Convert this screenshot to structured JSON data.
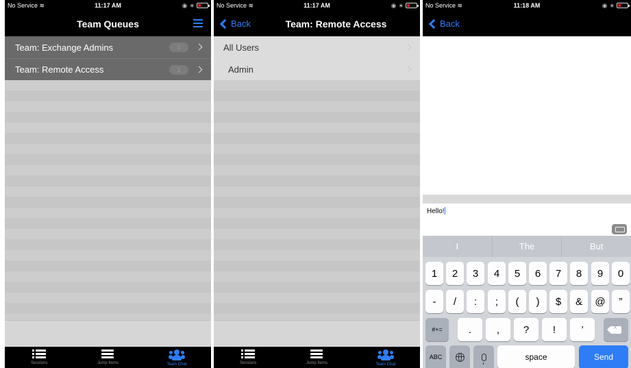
{
  "status_bars": [
    {
      "carrier": "No Service",
      "time": "11:17 AM"
    },
    {
      "carrier": "No Service",
      "time": "11:17 AM"
    },
    {
      "carrier": "No Service",
      "time": "11:18 AM"
    }
  ],
  "colors": {
    "accent": "#2f7df6",
    "nav_bg": "#000000",
    "queue_bg": "#6a6a6a",
    "battery": "#e02020"
  },
  "screen1": {
    "title": "Team Queues",
    "queues": [
      {
        "label": "Team: Exchange Admins",
        "count": "0"
      },
      {
        "label": "Team: Remote Access",
        "count": "1"
      }
    ]
  },
  "screen2": {
    "back_label": "Back",
    "title": "Team: Remote Access",
    "users": [
      {
        "label": "All Users"
      },
      {
        "label": "Admin"
      }
    ]
  },
  "screen3": {
    "back_label": "Back",
    "message_text": "Hello!",
    "predictions": [
      "I",
      "The",
      "But"
    ],
    "keys_row1": [
      "1",
      "2",
      "3",
      "4",
      "5",
      "6",
      "7",
      "8",
      "9",
      "0"
    ],
    "keys_row2": [
      "-",
      "/",
      ":",
      ";",
      "(",
      ")",
      "$",
      "&",
      "@",
      "”"
    ],
    "key_symbols": "#+=",
    "keys_row3": [
      ".",
      ",",
      "?",
      "!",
      "’"
    ],
    "key_abc": "ABC",
    "key_space": "space",
    "key_send": "Send"
  },
  "tabs": [
    {
      "label": "Sessions",
      "icon": "list-icon"
    },
    {
      "label": "Jump Items",
      "icon": "server-icon"
    },
    {
      "label": "Team Chat",
      "icon": "people-icon",
      "active": true
    }
  ]
}
